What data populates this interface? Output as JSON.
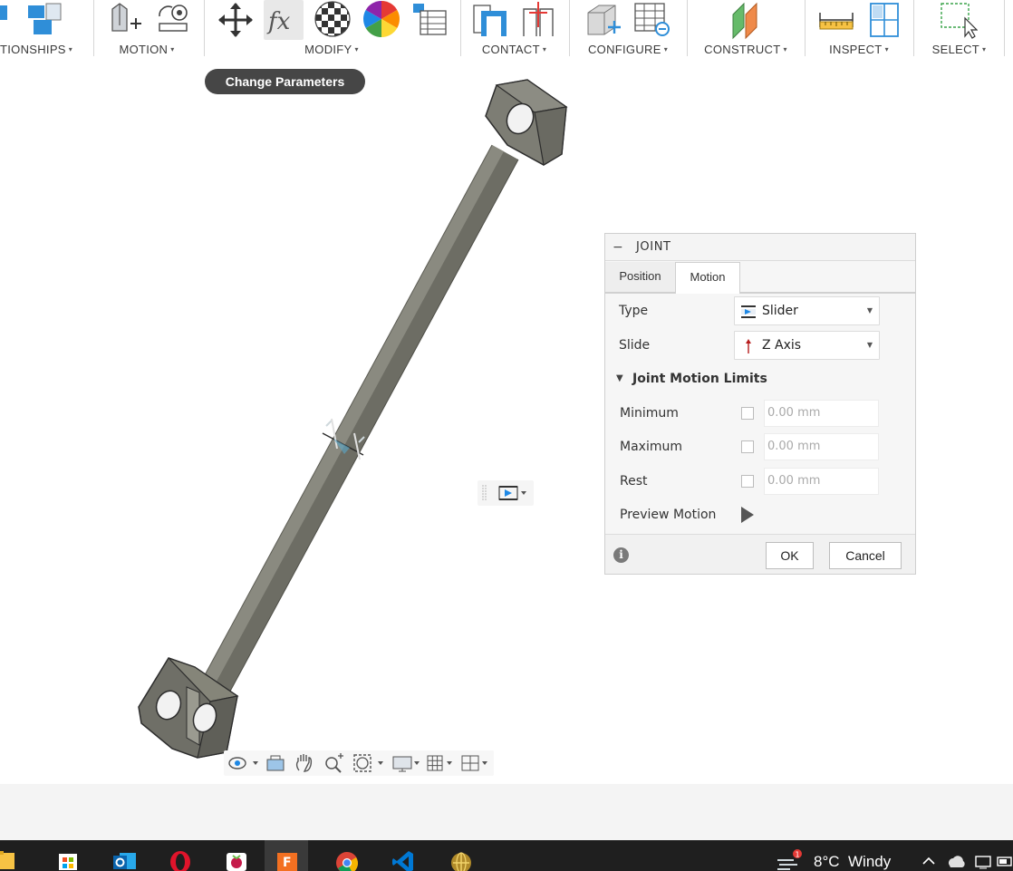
{
  "toolbar": {
    "groups": [
      {
        "label": "TIONSHIPS",
        "id": "relationships"
      },
      {
        "label": "MOTION",
        "id": "motion"
      },
      {
        "label": "MODIFY",
        "id": "modify"
      },
      {
        "label": "CONTACT",
        "id": "contact"
      },
      {
        "label": "CONFIGURE",
        "id": "configure"
      },
      {
        "label": "CONSTRUCT",
        "id": "construct"
      },
      {
        "label": "INSPECT",
        "id": "inspect"
      },
      {
        "label": "SELECT",
        "id": "select"
      }
    ],
    "caret": "▾"
  },
  "tooltip": {
    "text": "Change Parameters"
  },
  "joint_panel": {
    "collapse_symbol": "−",
    "title": "JOINT",
    "tabs": [
      {
        "label": "Position",
        "active": false
      },
      {
        "label": "Motion",
        "active": true
      }
    ],
    "type": {
      "label": "Type",
      "value": "Slider",
      "icon": "slider-icon"
    },
    "slide": {
      "label": "Slide",
      "value": "Z Axis",
      "icon": "z-axis-arrow-icon"
    },
    "limits_section": {
      "toggle": "▼",
      "title": "Joint Motion Limits"
    },
    "limits": [
      {
        "label": "Minimum",
        "checked": false,
        "value": "0.00 mm"
      },
      {
        "label": "Maximum",
        "checked": false,
        "value": "0.00 mm"
      },
      {
        "label": "Rest",
        "checked": false,
        "value": "0.00 mm"
      }
    ],
    "preview": {
      "label": "Preview Motion",
      "icon": "play-icon"
    },
    "info_icon": "i",
    "ok_label": "OK",
    "cancel_label": "Cancel"
  },
  "taskbar": {
    "apps": [
      "file-explorer",
      "microsoft-store",
      "outlook",
      "opera",
      "raspberry-pi-imager",
      "fusion-360",
      "chrome",
      "vscode",
      "globe-app"
    ],
    "active_app": "fusion-360",
    "weather": {
      "temperature": "8°C",
      "description": "Windy",
      "badge": "1"
    }
  },
  "colors": {
    "accent_blue": "#1e88e5",
    "model_gray": "#7b7b72",
    "tooltip_bg": "#464646",
    "taskbar_bg": "#1f1f1f"
  }
}
